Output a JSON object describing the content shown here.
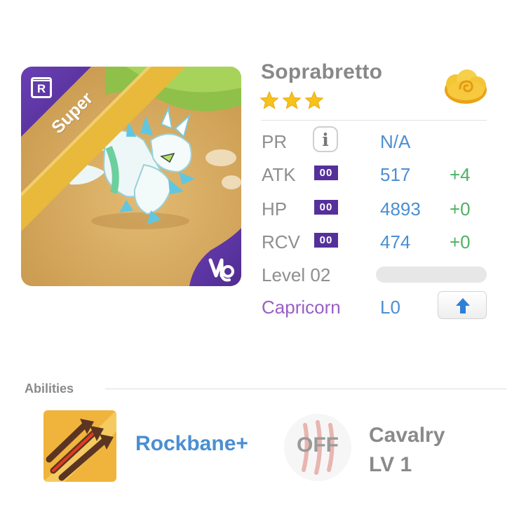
{
  "monster": {
    "name": "Soprabretto",
    "stars": 3,
    "rarity_ribbon": "Super",
    "frame_badge_icon": "r-badge-icon",
    "zodiac_icon": "capricorn-symbol-icon",
    "currency_icon": "gold-cloud-coin-icon"
  },
  "stats": {
    "pr": {
      "label": "PR",
      "value": "N/A",
      "info_icon": "info-icon"
    },
    "atk": {
      "label": "ATK",
      "badge": "00",
      "value": "517",
      "bonus": "+4"
    },
    "hp": {
      "label": "HP",
      "badge": "00",
      "value": "4893",
      "bonus": "+0"
    },
    "rcv": {
      "label": "RCV",
      "badge": "00",
      "value": "474",
      "bonus": "+0"
    }
  },
  "level": {
    "label": "Level 02",
    "progress": 0.0
  },
  "zodiac": {
    "label": "Capricorn",
    "level": "L0",
    "upgrade_icon": "arrow-up-icon"
  },
  "abilities": {
    "title": "Abilities",
    "ability": {
      "name": "Rockbane+",
      "icon": "triple-arrows-icon"
    },
    "skill": {
      "state": "OFF",
      "name_line1": "Cavalry",
      "name_line2": "LV 1",
      "icon": "claw-marks-icon"
    }
  },
  "colors": {
    "accent_blue": "#4a8fd1",
    "bonus_green": "#4fb063",
    "zodiac_purple": "#9a5fc4",
    "badge_purple": "#55309a",
    "ribbon_gold": "#e8b93a",
    "label_gray": "#8f8f8f"
  }
}
